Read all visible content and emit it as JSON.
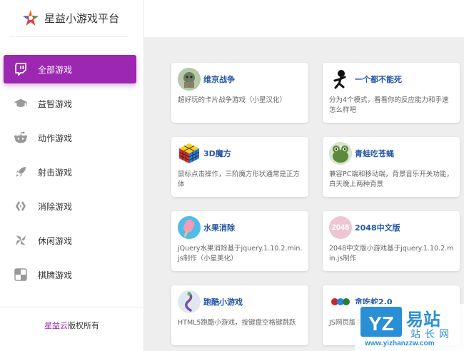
{
  "brand": {
    "title": "星益小游戏平台"
  },
  "nav": {
    "items": [
      {
        "label": "全部游戏",
        "icon": "twitch-icon",
        "active": true
      },
      {
        "label": "益智游戏",
        "icon": "graduation-cap-icon",
        "active": false
      },
      {
        "label": "动作游戏",
        "icon": "reddit-icon",
        "active": false
      },
      {
        "label": "射击游戏",
        "icon": "rocket-icon",
        "active": false
      },
      {
        "label": "消除游戏",
        "icon": "gg-icon",
        "active": false
      },
      {
        "label": "休闲游戏",
        "icon": "pinwheel-icon",
        "active": false
      },
      {
        "label": "棋牌游戏",
        "icon": "checker-icon",
        "active": false
      }
    ]
  },
  "footer": {
    "brand": "星益云",
    "text": "版权所有"
  },
  "games": [
    {
      "title": "维京战争",
      "desc": "超好玩的卡片战争游戏（小星汉化）",
      "icon": "viking-icon"
    },
    {
      "title": "一个都不能死",
      "desc": "分为4个模式，看看你的反应能力和手速怎么样吧",
      "icon": "stickman-icon"
    },
    {
      "title": "3D魔方",
      "desc": "鼠标点击操作，三阶魔方形状通常是正方体",
      "icon": "rubik-cube-icon"
    },
    {
      "title": "青蛙吃苍蝇",
      "desc": "兼容PC端和移动端，背景音乐开关功能，白天晚上两种背景",
      "icon": "frog-icon"
    },
    {
      "title": "水果消除",
      "desc": "jQuery水果消除基于jquery.1.10.2.min.js制作（小星美化）",
      "icon": "popsicle-icon"
    },
    {
      "title": "2048中文版",
      "desc": "2048中文版小游戏基于jquery.1.10.2.min.js制作",
      "icon": "2048-icon",
      "icon_text": "2048"
    },
    {
      "title": "跑酷小游戏",
      "desc": "HTML5跑酷小游戏，按键盘空格键跳跃",
      "icon": "runner-icon"
    },
    {
      "title": "贪吃蛇2.0",
      "desc": "JS网页版贪吃蛇小游戏（小星美化）",
      "icon": "snake-icon"
    }
  ],
  "watermark": {
    "main": "易站",
    "sub": "站长网",
    "url": "www.yizhanzzw.com",
    "logo": "YZ"
  },
  "colors": {
    "accent": "#9c27b0",
    "title_blue": "#2557a7",
    "main_bg": "#eeeeee"
  }
}
